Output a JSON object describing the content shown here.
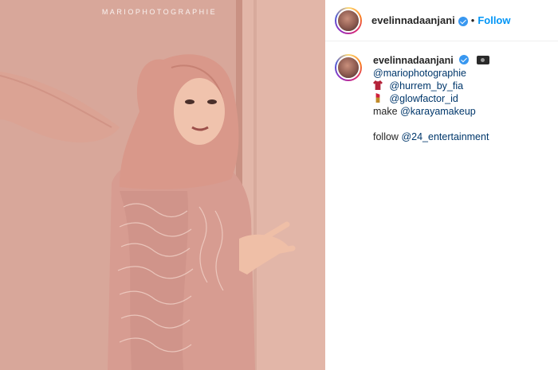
{
  "photo": {
    "watermark": "MARIOPHOTOGRAPHIE",
    "alt_subject": "woman in pink hijab and embellished dress"
  },
  "post_header": {
    "username": "evelinnadaanjani",
    "verified": true,
    "separator": "•",
    "follow_label": "Follow"
  },
  "caption": {
    "username": "evelinnadaanjani",
    "verified": true,
    "camera_icon": "camera-icon",
    "lines": {
      "photographer": "@mariophotographie",
      "outfit_icon": "shirt-icon",
      "outfit": "@hurrem_by_fia",
      "glow_icon": "lipstick-icon",
      "glow": "@glowfactor_id",
      "makeup_prefix": "make",
      "makeup": "@karayamakeup",
      "follow_prefix": "follow",
      "follow": "@24_entertainment"
    }
  },
  "colors": {
    "follow_blue": "#0095f6",
    "mention_blue": "#00376b",
    "verified_blue": "#3897f0",
    "photo_bg": "#d6a597"
  }
}
